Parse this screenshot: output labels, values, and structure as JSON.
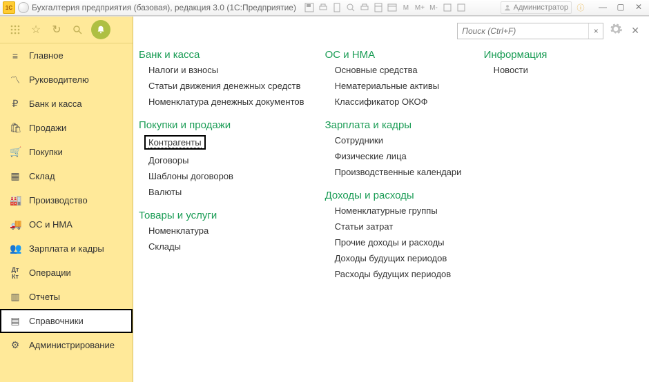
{
  "title": "Бухгалтерия предприятия (базовая), редакция 3.0  (1С:Предприятие)",
  "user": "Администратор",
  "toolbar_glyphs": [
    "M",
    "M+",
    "M-"
  ],
  "search": {
    "placeholder": "Поиск (Ctrl+F)"
  },
  "sidebar": {
    "items": [
      {
        "label": "Главное"
      },
      {
        "label": "Руководителю"
      },
      {
        "label": "Банк и касса"
      },
      {
        "label": "Продажи"
      },
      {
        "label": "Покупки"
      },
      {
        "label": "Склад"
      },
      {
        "label": "Производство"
      },
      {
        "label": "ОС и НМА"
      },
      {
        "label": "Зарплата и кадры"
      },
      {
        "label": "Операции"
      },
      {
        "label": "Отчеты"
      },
      {
        "label": "Справочники"
      },
      {
        "label": "Администрирование"
      }
    ]
  },
  "sections": {
    "col1": [
      {
        "title": "Банк и касса",
        "links": [
          "Налоги и взносы",
          "Статьи движения денежных средств",
          "Номенклатура денежных документов"
        ]
      },
      {
        "title": "Покупки и продажи",
        "links": [
          "Контрагенты",
          "Договоры",
          "Шаблоны договоров",
          "Валюты"
        ],
        "highlighted_index": 0
      },
      {
        "title": "Товары и услуги",
        "links": [
          "Номенклатура",
          "Склады"
        ]
      }
    ],
    "col2": [
      {
        "title": "ОС и НМА",
        "links": [
          "Основные средства",
          "Нематериальные активы",
          "Классификатор ОКОФ"
        ]
      },
      {
        "title": "Зарплата и кадры",
        "links": [
          "Сотрудники",
          "Физические лица",
          "Производственные календари"
        ]
      },
      {
        "title": "Доходы и расходы",
        "links": [
          "Номенклатурные группы",
          "Статьи затрат",
          "Прочие доходы и расходы",
          "Доходы будущих периодов",
          "Расходы будущих периодов"
        ]
      }
    ],
    "col3": [
      {
        "title": "Информация",
        "links": [
          "Новости"
        ]
      }
    ]
  }
}
